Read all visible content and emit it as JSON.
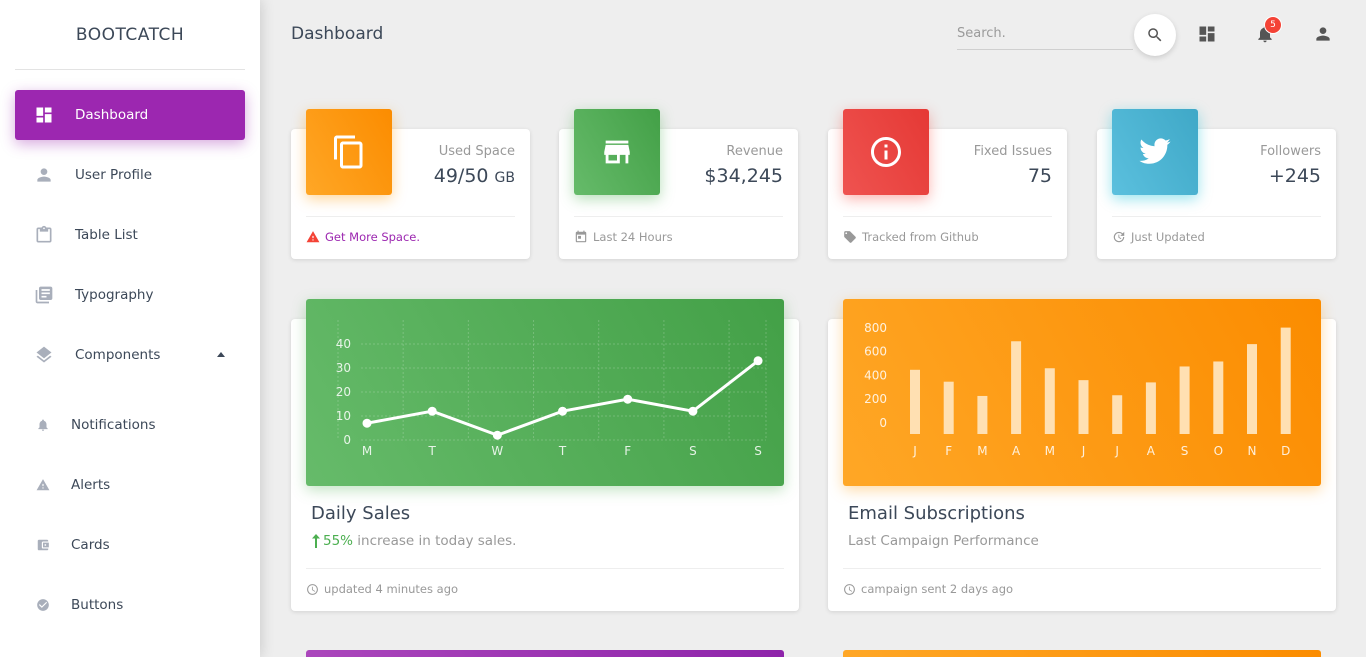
{
  "sidebar": {
    "brand": "BOOTCATCH",
    "items": [
      {
        "label": "Dashboard"
      },
      {
        "label": "User Profile"
      },
      {
        "label": "Table List"
      },
      {
        "label": "Typography"
      },
      {
        "label": "Components"
      }
    ],
    "sub_items": [
      {
        "label": "Notifications"
      },
      {
        "label": "Alerts"
      },
      {
        "label": "Cards"
      },
      {
        "label": "Buttons"
      }
    ]
  },
  "header": {
    "title": "Dashboard",
    "search_placeholder": "Search.",
    "notification_count": "5"
  },
  "stats": [
    {
      "category": "Used Space",
      "value": "49/50",
      "unit": "GB",
      "footer": "Get More Space.",
      "color": "#fb8c00"
    },
    {
      "category": "Revenue",
      "value": "$34,245",
      "footer": "Last 24 Hours",
      "color": "#43a047"
    },
    {
      "category": "Fixed Issues",
      "value": "75",
      "footer": "Tracked from Github",
      "color": "#e53935"
    },
    {
      "category": "Followers",
      "value": "+245",
      "footer": "Just Updated",
      "color": "#00acc1"
    }
  ],
  "daily_sales": {
    "title": "Daily Sales",
    "increase": "55%",
    "subtitle_rest": " increase in today sales.",
    "footer": "updated 4 minutes ago"
  },
  "email_subscriptions": {
    "title": "Email Subscriptions",
    "subtitle": "Last Campaign Performance",
    "footer": "campaign sent 2 days ago"
  },
  "chart_data": [
    {
      "type": "line",
      "categories": [
        "M",
        "T",
        "W",
        "T",
        "F",
        "S",
        "S"
      ],
      "values": [
        7,
        12,
        2,
        12,
        17,
        12,
        33
      ],
      "ylim": [
        0,
        45
      ],
      "yticks": [
        0,
        10,
        20,
        30,
        40
      ],
      "grid": true,
      "color": "#ffffff"
    },
    {
      "type": "bar",
      "categories": [
        "J",
        "F",
        "M",
        "A",
        "M",
        "J",
        "J",
        "A",
        "S",
        "O",
        "N",
        "D"
      ],
      "values": [
        540,
        440,
        320,
        780,
        553,
        453,
        326,
        434,
        568,
        610,
        756,
        895
      ],
      "ylim": [
        0,
        900
      ],
      "yticks": [
        0,
        200,
        400,
        600,
        800
      ],
      "grid": false,
      "color": "#ffe0b2"
    }
  ]
}
